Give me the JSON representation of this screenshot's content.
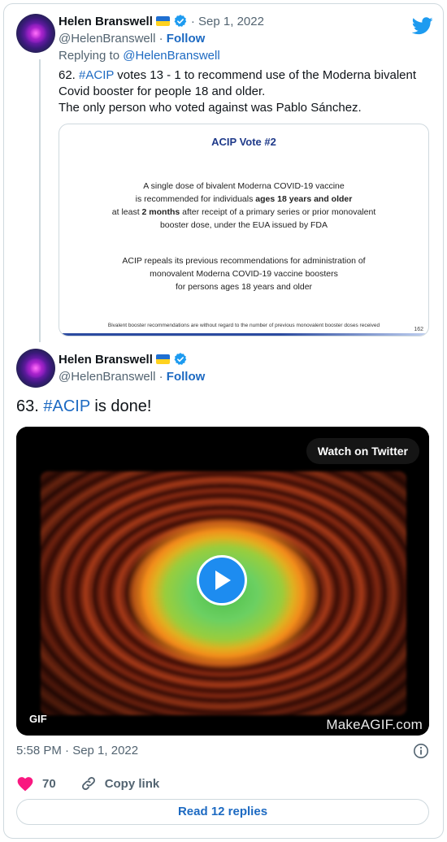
{
  "colors": {
    "link": "#1d6ac2",
    "muted": "#536471",
    "text": "#0f1419",
    "twitter_blue": "#1d9bf0",
    "like": "#f91880"
  },
  "tweet1": {
    "author_name": "Helen Branswell",
    "date": "· Sep 1, 2022",
    "handle": "@HelenBranswell",
    "sep": "·",
    "follow": "Follow",
    "replying_prefix": "Replying to ",
    "replying_handle": "@HelenBranswell",
    "text_number": "62. ",
    "hashtag": "#ACIP",
    "text_line1_rest": " votes 13 - 1  to recommend use of the Moderna bivalent",
    "text_line2": "Covid booster for people 18 and older.",
    "text_line3": "The only person who voted against was Pablo Sánchez.",
    "slide": {
      "title": "ACIP Vote #2",
      "p1_l1": "A single dose of bivalent Moderna COVID-19 vaccine",
      "p1_l2a": "is recommended for individuals ",
      "p1_l2b": "ages 18 years and older",
      "p1_l3a": "at least ",
      "p1_l3b": "2 months",
      "p1_l3c": " after receipt of a primary series or prior monovalent",
      "p1_l4": "booster dose, under the EUA issued by FDA",
      "p2_l1": "ACIP repeals its previous recommendations for administration of",
      "p2_l2": "monovalent Moderna COVID-19 vaccine boosters",
      "p2_l3": "for persons ages 18 years and older",
      "footnote": "Bivalent booster recommendations are without regard to the number of previous monovalent booster doses received",
      "page_number": "162"
    }
  },
  "tweet2": {
    "author_name": "Helen Branswell",
    "handle": "@HelenBranswell",
    "sep": "·",
    "follow": "Follow",
    "text_prefix": "63. ",
    "hashtag": "#ACIP",
    "text_suffix": " is done!",
    "media": {
      "watch_label": "Watch on Twitter",
      "gif_badge": "GIF",
      "watermark": "MakeAGIF.com"
    },
    "timestamp": "5:58 PM · Sep 1, 2022",
    "like_count": "70",
    "copy_link": "Copy link",
    "read_replies": "Read 12 replies"
  }
}
